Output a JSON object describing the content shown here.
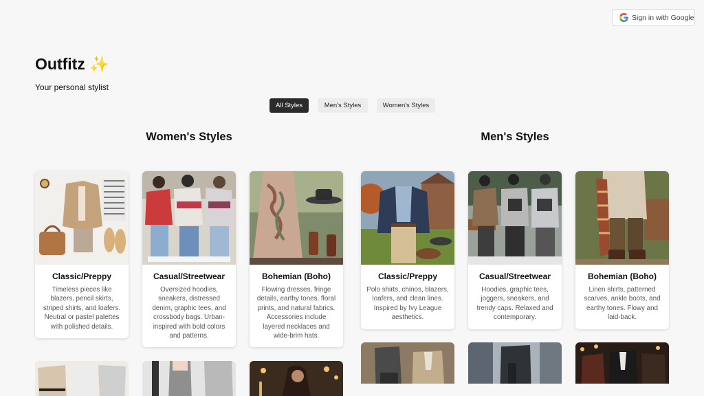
{
  "header": {
    "signin_label": "Sign in with Google"
  },
  "brand": {
    "title": "Outfitz ✨",
    "subtitle": "Your personal stylist"
  },
  "filters": {
    "all": "All Styles",
    "men": "Men's Styles",
    "women": "Women's Styles",
    "selected": "All Styles"
  },
  "sections": {
    "women_title": "Women's Styles",
    "men_title": "Men's Styles"
  },
  "women_cards": [
    {
      "title": "Classic/Preppy",
      "desc": "Timeless pieces like blazers, pencil skirts, striped shirts, and loafers. Neutral or pastel palettes with polished details."
    },
    {
      "title": "Casual/Streetwear",
      "desc": "Oversized hoodies, sneakers, distressed denim, graphic tees, and crossbody bags. Urban-inspired with bold colors and patterns."
    },
    {
      "title": "Bohemian (Boho)",
      "desc": "Flowing dresses, fringe details, earthy tones, floral prints, and natural fabrics. Accessories include layered necklaces and wide-brim hats."
    }
  ],
  "men_cards": [
    {
      "title": "Classic/Preppy",
      "desc": "Polo shirts, chinos, blazers, loafers, and clean lines. Inspired by Ivy League aesthetics."
    },
    {
      "title": "Casual/Streetwear",
      "desc": "Hoodies, graphic tees, joggers, sneakers, and trendy caps. Relaxed and contemporary."
    },
    {
      "title": "Bohemian (Boho)",
      "desc": "Linen shirts, patterned scarves, ankle boots, and earthy tones. Flowy and laid-back."
    }
  ],
  "colors": {
    "background": "#f7f7f7",
    "chip_active": "#2b2b2b",
    "chip_inactive": "#ececec"
  }
}
